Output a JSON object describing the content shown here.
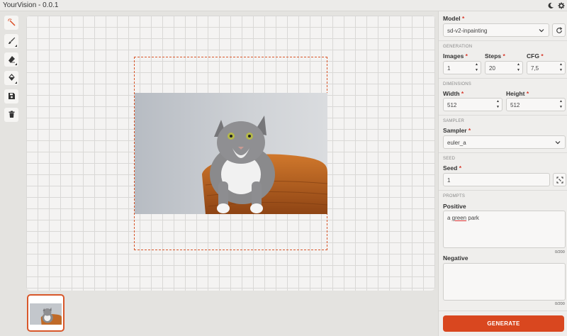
{
  "app": {
    "title": "YourVision - 0.0.1",
    "theme_icon": "moon-icon",
    "settings_icon": "gear-icon"
  },
  "tools": [
    {
      "name": "select-tool",
      "icon": "magic-select-icon",
      "active": true
    },
    {
      "name": "brush-tool",
      "icon": "brush-icon"
    },
    {
      "name": "eraser-tool",
      "icon": "eraser-icon"
    },
    {
      "name": "fill-tool",
      "icon": "bucket-icon"
    },
    {
      "name": "save-tool",
      "icon": "floppy-icon"
    },
    {
      "name": "delete-tool",
      "icon": "trash-icon"
    }
  ],
  "panel": {
    "model": {
      "label": "Model",
      "value": "sd-v2-inpainting"
    },
    "generation": {
      "section": "Generation",
      "images": {
        "label": "Images",
        "value": "1"
      },
      "steps": {
        "label": "Steps",
        "value": "20"
      },
      "cfg": {
        "label": "CFG",
        "value": "7,5"
      }
    },
    "dimensions": {
      "section": "Dimensions",
      "width": {
        "label": "Width",
        "value": "512"
      },
      "height": {
        "label": "Height",
        "value": "512"
      }
    },
    "sampler": {
      "section": "Sampler",
      "label": "Sampler",
      "value": "euler_a"
    },
    "seed": {
      "section": "Seed",
      "label": "Seed",
      "value": "1"
    },
    "prompts": {
      "section": "Prompts",
      "positive": {
        "label": "Positive",
        "value_before": "a ",
        "value_underlined": "green",
        "value_after": " park",
        "counter": "0/200"
      },
      "negative": {
        "label": "Negative",
        "value": "",
        "counter": "0/200"
      }
    },
    "generate_label": "GENERATE"
  },
  "colors": {
    "accent": "#d9471f",
    "required": "#d8372a"
  }
}
